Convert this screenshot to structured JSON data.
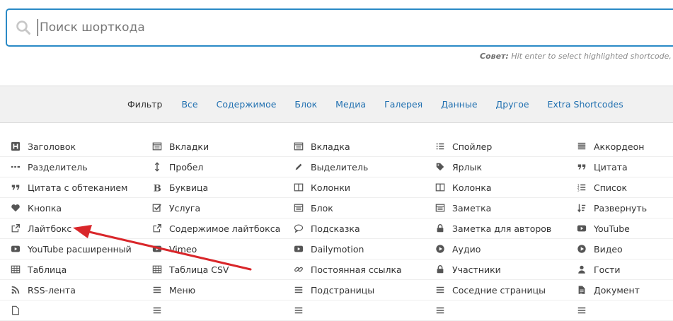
{
  "search": {
    "placeholder": "Поиск шорткода",
    "value": ""
  },
  "tip": {
    "label": "Совет:",
    "text": " Hit enter to select highlighted shortcode, whil"
  },
  "filter": {
    "label": "Фильтр",
    "links": [
      "Все",
      "Содержимое",
      "Блок",
      "Медиа",
      "Галерея",
      "Данные",
      "Другое",
      "Extra Shortcodes"
    ]
  },
  "shortcodes": [
    [
      {
        "label": "Заголовок",
        "icon": "heading-icon"
      },
      {
        "label": "Вкладки",
        "icon": "tabs-icon"
      },
      {
        "label": "Вкладка",
        "icon": "tab-icon"
      },
      {
        "label": "Спойлер",
        "icon": "list-icon"
      },
      {
        "label": "Аккордеон",
        "icon": "accordion-icon"
      }
    ],
    [
      {
        "label": "Разделитель",
        "icon": "divider-icon"
      },
      {
        "label": "Пробел",
        "icon": "spacer-icon"
      },
      {
        "label": "Выделитель",
        "icon": "pencil-icon"
      },
      {
        "label": "Ярлык",
        "icon": "tag-icon"
      },
      {
        "label": "Цитата",
        "icon": "quote-icon"
      }
    ],
    [
      {
        "label": "Цитата с обтеканием",
        "icon": "quote-icon"
      },
      {
        "label": "Буквица",
        "icon": "bold-b-icon"
      },
      {
        "label": "Колонки",
        "icon": "columns-icon"
      },
      {
        "label": "Колонка",
        "icon": "columns-icon"
      },
      {
        "label": "Список",
        "icon": "ordered-list-icon"
      }
    ],
    [
      {
        "label": "Кнопка",
        "icon": "heart-icon"
      },
      {
        "label": "Услуга",
        "icon": "checkbox-icon"
      },
      {
        "label": "Блок",
        "icon": "box-icon"
      },
      {
        "label": "Заметка",
        "icon": "note-icon"
      },
      {
        "label": "Развернуть",
        "icon": "sort-icon"
      }
    ],
    [
      {
        "label": "Лайтбокс",
        "icon": "external-link-icon"
      },
      {
        "label": "Содержимое лайтбокса",
        "icon": "external-link-icon"
      },
      {
        "label": "Подсказка",
        "icon": "speech-bubble-icon"
      },
      {
        "label": "Заметка для авторов",
        "icon": "lock-icon"
      },
      {
        "label": "YouTube",
        "icon": "youtube-icon"
      }
    ],
    [
      {
        "label": "YouTube расширенный",
        "icon": "youtube-icon"
      },
      {
        "label": "Vimeo",
        "icon": "youtube-icon"
      },
      {
        "label": "Dailymotion",
        "icon": "youtube-icon"
      },
      {
        "label": "Аудио",
        "icon": "play-circle-icon"
      },
      {
        "label": "Видео",
        "icon": "play-circle-icon"
      }
    ],
    [
      {
        "label": "Таблица",
        "icon": "table-icon"
      },
      {
        "label": "Таблица CSV",
        "icon": "table-icon"
      },
      {
        "label": "Постоянная ссылка",
        "icon": "link-icon"
      },
      {
        "label": "Участники",
        "icon": "lock-icon"
      },
      {
        "label": "Гости",
        "icon": "user-icon"
      }
    ],
    [
      {
        "label": "RSS-лента",
        "icon": "rss-icon"
      },
      {
        "label": "Меню",
        "icon": "menu-icon"
      },
      {
        "label": "Подстраницы",
        "icon": "menu-icon"
      },
      {
        "label": "Соседние страницы",
        "icon": "menu-icon"
      },
      {
        "label": "Документ",
        "icon": "document-icon"
      }
    ],
    [
      {
        "label": "",
        "icon": "file-icon"
      },
      {
        "label": "",
        "icon": "menu-icon"
      },
      {
        "label": "",
        "icon": "menu-icon"
      },
      {
        "label": "",
        "icon": "menu-icon"
      },
      {
        "label": "",
        "icon": "menu-icon"
      }
    ]
  ],
  "colors": {
    "accent": "#2a8ac6",
    "link": "#2271b1",
    "icon": "#555555",
    "annotation_arrow": "#d9262a"
  }
}
